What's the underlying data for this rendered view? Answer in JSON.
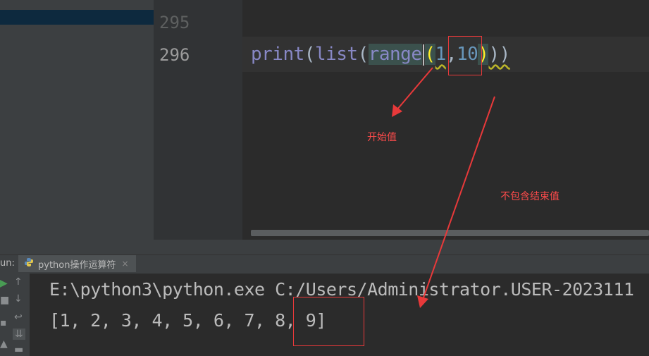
{
  "editor": {
    "line_numbers": [
      "295",
      "296"
    ],
    "code": {
      "print": "print",
      "open1": "(",
      "list": "list",
      "open2": "(",
      "range": "range",
      "open3": "(",
      "start": "1",
      "comma": ",",
      "stop": "10",
      "close3": ")",
      "close_rest": "))"
    }
  },
  "run_panel": {
    "label": "un:",
    "tab_label": "python操作运算符",
    "tab_close": "×",
    "console_lines": [
      "E:\\python3\\python.exe C:/Users/Administrator.USER-2023111",
      "[1, 2, 3, 4, 5, 6, 7, 8, 9]"
    ]
  },
  "annotations": {
    "start_value": "开始值",
    "exclusive_end": "不包含结束值"
  },
  "colors": {
    "annotation_red": "#e8393a",
    "keyword": "#8888c6",
    "number": "#6897bb",
    "bracket_highlight": "#ffef28"
  }
}
